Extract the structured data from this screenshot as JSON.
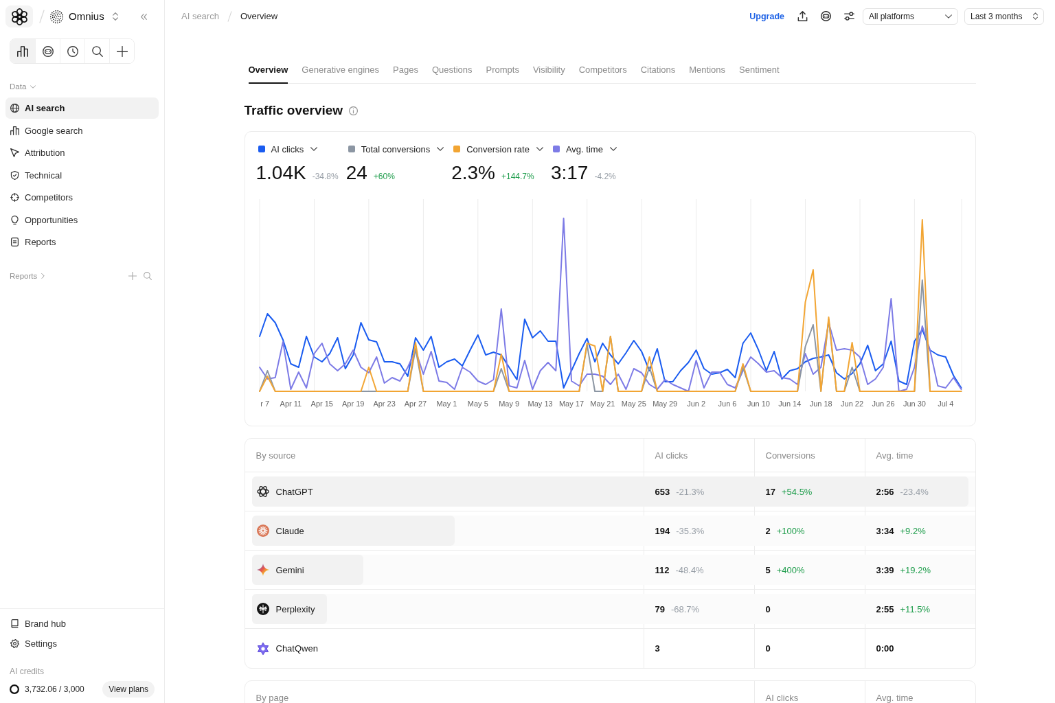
{
  "sidebar": {
    "workspace": "Omnius",
    "toolbar": [
      {
        "selected": true
      },
      {
        "selected": false
      },
      {
        "selected": false
      },
      {
        "selected": false
      },
      {
        "selected": false
      }
    ],
    "section": "Data",
    "nav": [
      {
        "label": "AI search",
        "selected": true
      },
      {
        "label": "Google search",
        "selected": false
      },
      {
        "label": "Attribution",
        "selected": false
      },
      {
        "label": "Technical",
        "selected": false
      },
      {
        "label": "Competitors",
        "selected": false
      },
      {
        "label": "Opportunities",
        "selected": false
      },
      {
        "label": "Reports",
        "selected": false
      }
    ],
    "reports_section": "Reports",
    "footer_nav": [
      "Brand hub",
      "Settings"
    ],
    "credits": {
      "label": "AI credits",
      "value": "3,732.06 / 3,000",
      "button": "View plans"
    }
  },
  "topbar": {
    "breadcrumbs": [
      "AI search",
      "Overview"
    ],
    "upgrade": "Upgrade",
    "platform_select": "All platforms",
    "range_select": "Last 3 months"
  },
  "tabs": [
    {
      "label": "Overview",
      "selected": true
    },
    {
      "label": "Generative engines",
      "selected": false
    },
    {
      "label": "Pages",
      "selected": false
    },
    {
      "label": "Questions",
      "selected": false
    },
    {
      "label": "Prompts",
      "selected": false
    },
    {
      "label": "Visibility",
      "selected": false
    },
    {
      "label": "Competitors",
      "selected": false
    },
    {
      "label": "Citations",
      "selected": false
    },
    {
      "label": "Mentions",
      "selected": false
    },
    {
      "label": "Sentiment",
      "selected": false
    }
  ],
  "traffic_overview": {
    "title": "Traffic overview",
    "metrics": [
      {
        "label": "AI clicks",
        "color": "#1a5cf0",
        "value": "1.04K",
        "change": "-34.8%",
        "positive": false
      },
      {
        "label": "Total conversions",
        "color": "#8c96a3",
        "value": "24",
        "change": "+60%",
        "positive": true
      },
      {
        "label": "Conversion rate",
        "color": "#f2a533",
        "value": "2.3%",
        "change": "+144.7%",
        "positive": true
      },
      {
        "label": "Avg. time",
        "color": "#7d7be6",
        "value": "3:17",
        "change": "-4.2%",
        "positive": false
      }
    ],
    "chart": {
      "axis_labels": [
        "r 7",
        "Apr 11",
        "Apr 15",
        "Apr 19",
        "Apr 23",
        "Apr 27",
        "May 1",
        "May 5",
        "May 9",
        "May 13",
        "May 17",
        "May 21",
        "May 25",
        "May 29",
        "Jun 2",
        "Jun 6",
        "Jun 10",
        "Jun 14",
        "Jun 18",
        "Jun 22",
        "Jun 26",
        "Jun 30",
        "Jul 4"
      ]
    }
  },
  "by_source": {
    "columns": [
      "By source",
      "AI clicks",
      "Conversions",
      "Avg. time"
    ],
    "rows": [
      {
        "level": 0.991,
        "cells": [
          {
            "value": "ChatGPT"
          },
          {
            "value": "653",
            "change": "-21.3%",
            "positive": false
          },
          {
            "value": "17",
            "change": "+54.5%",
            "positive": true
          },
          {
            "value": "2:56",
            "change": "-23.4%",
            "positive": false
          }
        ]
      },
      {
        "level": 0.281,
        "cells": [
          {
            "value": "Claude"
          },
          {
            "value": "194",
            "change": "-35.3%",
            "positive": false
          },
          {
            "value": "2",
            "change": "+100%",
            "positive": true
          },
          {
            "value": "3:34",
            "change": "+9.2%",
            "positive": true
          }
        ]
      },
      {
        "level": 0.154,
        "cells": [
          {
            "value": "Gemini"
          },
          {
            "value": "112",
            "change": "-48.4%",
            "positive": false
          },
          {
            "value": "5",
            "change": "+400%",
            "positive": true
          },
          {
            "value": "3:39",
            "change": "+19.2%",
            "positive": true
          }
        ]
      },
      {
        "level": 0.104,
        "cells": [
          {
            "value": "Perplexity"
          },
          {
            "value": "79",
            "change": "-68.7%",
            "positive": false
          },
          {
            "value": "0"
          },
          {
            "value": "2:55",
            "change": "+11.5%",
            "positive": true
          }
        ]
      },
      {
        "cells": [
          {
            "value": "ChatQwen"
          },
          {
            "value": "3"
          },
          {
            "value": "0"
          },
          {
            "value": "0:00"
          }
        ]
      }
    ]
  },
  "by_page": {
    "columns": [
      "By page",
      "AI clicks",
      "Avg. time"
    ]
  }
}
